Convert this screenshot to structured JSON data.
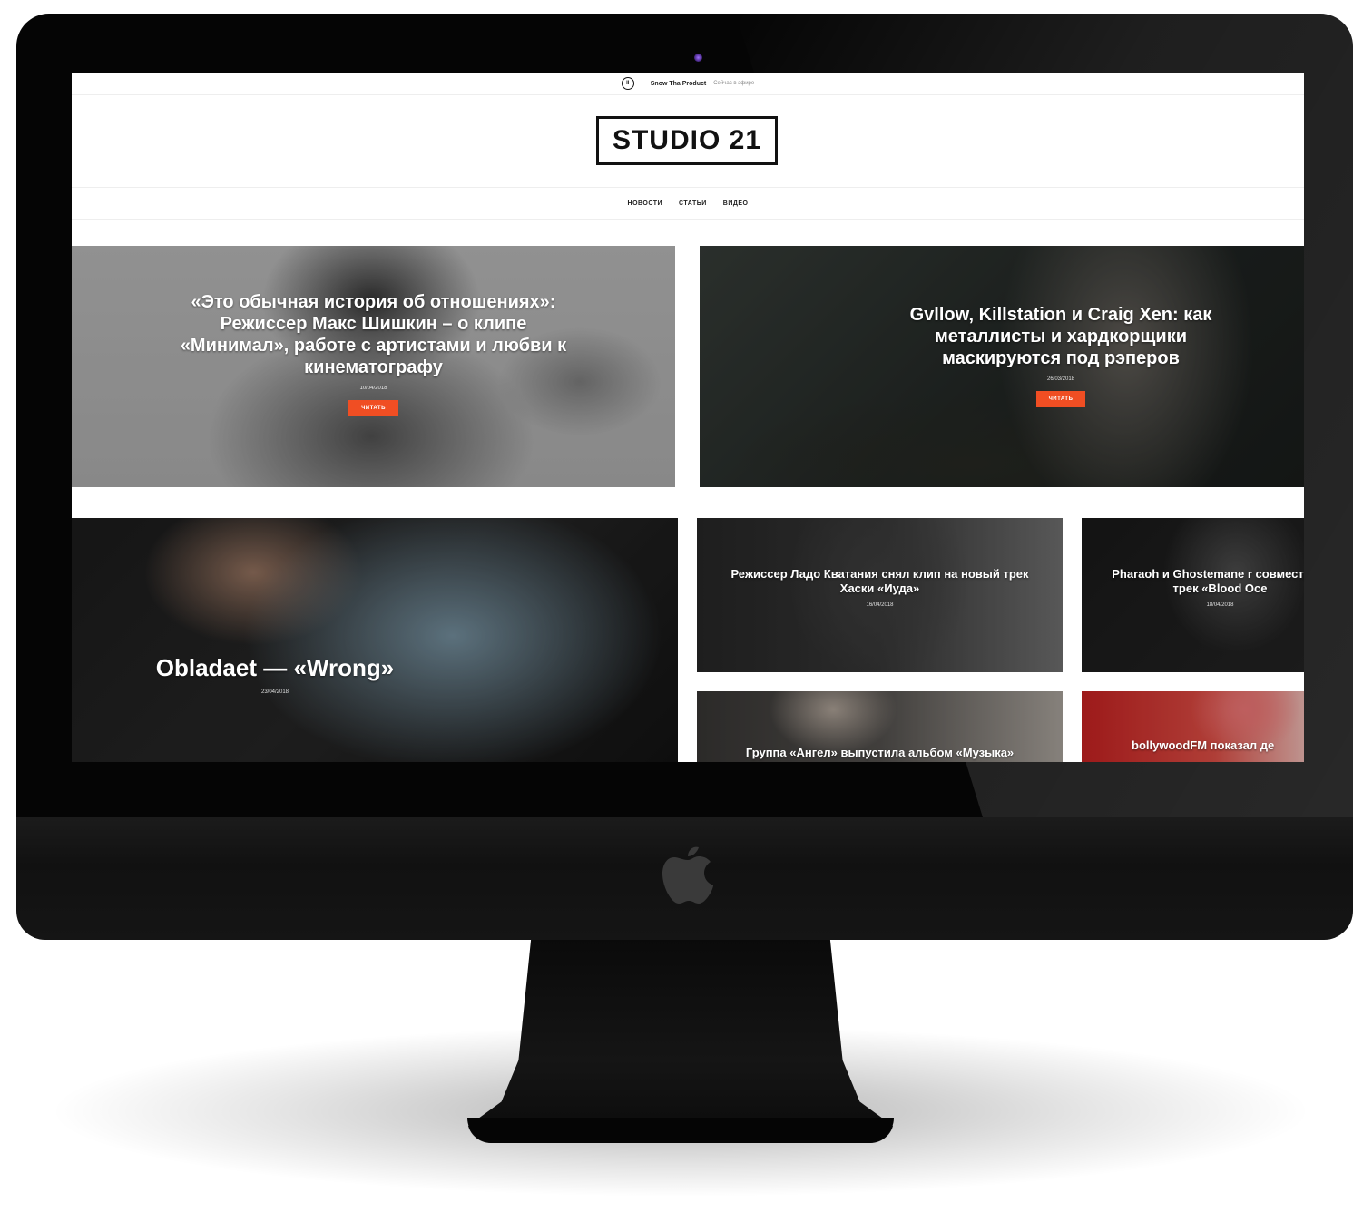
{
  "now_playing": {
    "icon": "play-pause-icon",
    "play_label": "II",
    "artist": "Snow Tha Product",
    "status": "Сейчас в эфире"
  },
  "brand": {
    "logo_text": "STUDIO 21"
  },
  "nav": {
    "items": [
      {
        "label": "НОВОСТИ"
      },
      {
        "label": "СТАТЬИ"
      },
      {
        "label": "ВИДЕО"
      }
    ]
  },
  "colors": {
    "accent": "#f04e23"
  },
  "featured": [
    {
      "title": "«Это обычная история об отношениях»: Режиссер Макс Шишкин – о клипе «Минимал», работе с артистами и любви к кинематографу",
      "date": "10/04/2018",
      "button": "ЧИТАТЬ"
    },
    {
      "title": "Gvllow, Killstation и Craig Xen: как металлисты и хардкорщики маскируются под рэперов",
      "date": "26/03/2018",
      "button": "ЧИТАТЬ"
    }
  ],
  "grid": [
    {
      "title": "Obladaet — «Wrong»",
      "date": "23/04/2018"
    },
    {
      "title": "Режиссер Ладо Кватания снял клип на новый трек Хаски «Иуда»",
      "date": "16/04/2018"
    },
    {
      "title": "Pharaoh и Ghostemane r совместный трек «Blood Oce",
      "date": "18/04/2018"
    },
    {
      "title": "Группа «Ангел» выпустила альбом «Музыка»",
      "date": ""
    },
    {
      "title": "bollywoodFM показал де",
      "date": ""
    }
  ]
}
